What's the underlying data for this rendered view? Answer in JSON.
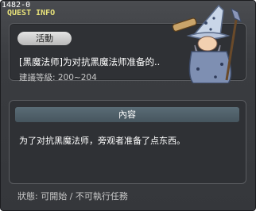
{
  "window": {
    "quest_id": "1482-0",
    "title": "QUEST INFO"
  },
  "quest": {
    "category": "活動",
    "name": "[黑魔法师]为对抗黑魔法师准备的..",
    "level_text": "建議等級: 200~204"
  },
  "content": {
    "header": "內容",
    "text": "为了对抗黑魔法师，旁观者准备了点东西。"
  },
  "status": {
    "text": "狀態: 可開始 / 不可執行任務"
  },
  "npc": {
    "icon": "wizard-npc-icon"
  },
  "colors": {
    "title": "#e8e27a",
    "panel": "#2f3135",
    "header_bar": "#4f606a"
  }
}
